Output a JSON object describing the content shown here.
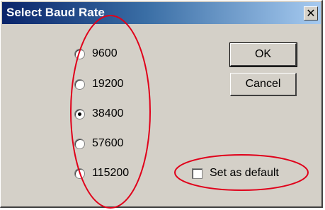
{
  "window": {
    "title": "Select Baud Rate",
    "close_glyph": "✕"
  },
  "baud_rates": [
    {
      "label": "9600",
      "checked": false
    },
    {
      "label": "19200",
      "checked": false
    },
    {
      "label": "38400",
      "checked": true
    },
    {
      "label": "57600",
      "checked": false
    },
    {
      "label": "115200",
      "checked": false
    }
  ],
  "buttons": {
    "ok_label": "OK",
    "cancel_label": "Cancel"
  },
  "default_checkbox": {
    "label": "Set as default",
    "checked": false
  },
  "colors": {
    "annotation": "#e0001a",
    "face": "#d4d0c8",
    "title_start": "#0a246a"
  }
}
